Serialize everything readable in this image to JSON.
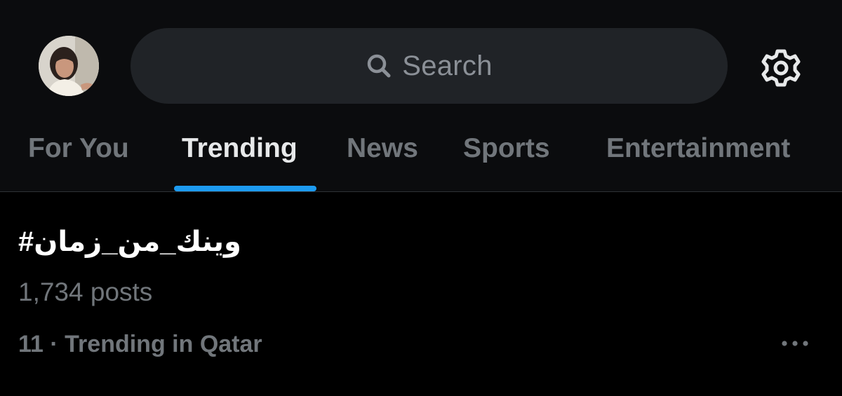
{
  "header": {
    "avatar_icon": "profile-avatar",
    "search": {
      "placeholder": "Search",
      "icon": "search-icon"
    },
    "settings_icon": "gear-icon"
  },
  "tabs": [
    {
      "label": "For You",
      "active": false
    },
    {
      "label": "Trending",
      "active": true
    },
    {
      "label": "News",
      "active": false
    },
    {
      "label": "Sports",
      "active": false
    },
    {
      "label": "Entertainment",
      "active": false
    }
  ],
  "trend": {
    "name": "#وينك_من_زمان",
    "posts": "1,734 posts",
    "meta": "11 · Trending in Qatar",
    "more_icon": "more-horizontal-icon"
  },
  "colors": {
    "accent": "#1d9bf0",
    "background": "#000000",
    "header_background": "#0b0c0e",
    "search_background": "#202327",
    "muted_text": "#71767b",
    "primary_text": "#e7e9ea"
  }
}
